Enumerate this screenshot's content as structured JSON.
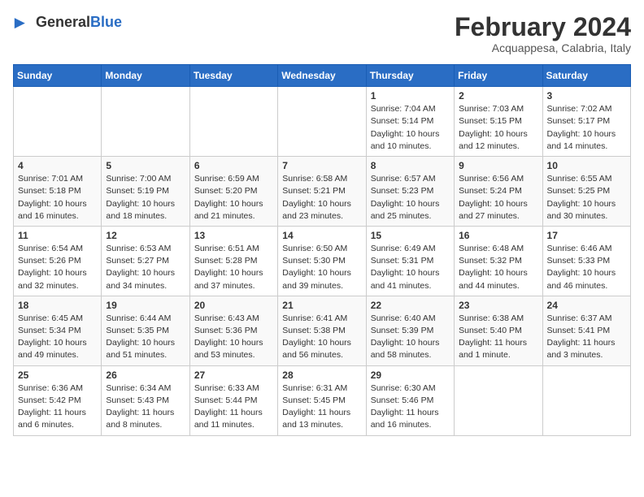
{
  "logo": {
    "text_general": "General",
    "text_blue": "Blue",
    "icon": "▶"
  },
  "title": "February 2024",
  "subtitle": "Acquappesa, Calabria, Italy",
  "days_of_week": [
    "Sunday",
    "Monday",
    "Tuesday",
    "Wednesday",
    "Thursday",
    "Friday",
    "Saturday"
  ],
  "weeks": [
    [
      {
        "day": "",
        "info": ""
      },
      {
        "day": "",
        "info": ""
      },
      {
        "day": "",
        "info": ""
      },
      {
        "day": "",
        "info": ""
      },
      {
        "day": "1",
        "info": "Sunrise: 7:04 AM\nSunset: 5:14 PM\nDaylight: 10 hours\nand 10 minutes."
      },
      {
        "day": "2",
        "info": "Sunrise: 7:03 AM\nSunset: 5:15 PM\nDaylight: 10 hours\nand 12 minutes."
      },
      {
        "day": "3",
        "info": "Sunrise: 7:02 AM\nSunset: 5:17 PM\nDaylight: 10 hours\nand 14 minutes."
      }
    ],
    [
      {
        "day": "4",
        "info": "Sunrise: 7:01 AM\nSunset: 5:18 PM\nDaylight: 10 hours\nand 16 minutes."
      },
      {
        "day": "5",
        "info": "Sunrise: 7:00 AM\nSunset: 5:19 PM\nDaylight: 10 hours\nand 18 minutes."
      },
      {
        "day": "6",
        "info": "Sunrise: 6:59 AM\nSunset: 5:20 PM\nDaylight: 10 hours\nand 21 minutes."
      },
      {
        "day": "7",
        "info": "Sunrise: 6:58 AM\nSunset: 5:21 PM\nDaylight: 10 hours\nand 23 minutes."
      },
      {
        "day": "8",
        "info": "Sunrise: 6:57 AM\nSunset: 5:23 PM\nDaylight: 10 hours\nand 25 minutes."
      },
      {
        "day": "9",
        "info": "Sunrise: 6:56 AM\nSunset: 5:24 PM\nDaylight: 10 hours\nand 27 minutes."
      },
      {
        "day": "10",
        "info": "Sunrise: 6:55 AM\nSunset: 5:25 PM\nDaylight: 10 hours\nand 30 minutes."
      }
    ],
    [
      {
        "day": "11",
        "info": "Sunrise: 6:54 AM\nSunset: 5:26 PM\nDaylight: 10 hours\nand 32 minutes."
      },
      {
        "day": "12",
        "info": "Sunrise: 6:53 AM\nSunset: 5:27 PM\nDaylight: 10 hours\nand 34 minutes."
      },
      {
        "day": "13",
        "info": "Sunrise: 6:51 AM\nSunset: 5:28 PM\nDaylight: 10 hours\nand 37 minutes."
      },
      {
        "day": "14",
        "info": "Sunrise: 6:50 AM\nSunset: 5:30 PM\nDaylight: 10 hours\nand 39 minutes."
      },
      {
        "day": "15",
        "info": "Sunrise: 6:49 AM\nSunset: 5:31 PM\nDaylight: 10 hours\nand 41 minutes."
      },
      {
        "day": "16",
        "info": "Sunrise: 6:48 AM\nSunset: 5:32 PM\nDaylight: 10 hours\nand 44 minutes."
      },
      {
        "day": "17",
        "info": "Sunrise: 6:46 AM\nSunset: 5:33 PM\nDaylight: 10 hours\nand 46 minutes."
      }
    ],
    [
      {
        "day": "18",
        "info": "Sunrise: 6:45 AM\nSunset: 5:34 PM\nDaylight: 10 hours\nand 49 minutes."
      },
      {
        "day": "19",
        "info": "Sunrise: 6:44 AM\nSunset: 5:35 PM\nDaylight: 10 hours\nand 51 minutes."
      },
      {
        "day": "20",
        "info": "Sunrise: 6:43 AM\nSunset: 5:36 PM\nDaylight: 10 hours\nand 53 minutes."
      },
      {
        "day": "21",
        "info": "Sunrise: 6:41 AM\nSunset: 5:38 PM\nDaylight: 10 hours\nand 56 minutes."
      },
      {
        "day": "22",
        "info": "Sunrise: 6:40 AM\nSunset: 5:39 PM\nDaylight: 10 hours\nand 58 minutes."
      },
      {
        "day": "23",
        "info": "Sunrise: 6:38 AM\nSunset: 5:40 PM\nDaylight: 11 hours\nand 1 minute."
      },
      {
        "day": "24",
        "info": "Sunrise: 6:37 AM\nSunset: 5:41 PM\nDaylight: 11 hours\nand 3 minutes."
      }
    ],
    [
      {
        "day": "25",
        "info": "Sunrise: 6:36 AM\nSunset: 5:42 PM\nDaylight: 11 hours\nand 6 minutes."
      },
      {
        "day": "26",
        "info": "Sunrise: 6:34 AM\nSunset: 5:43 PM\nDaylight: 11 hours\nand 8 minutes."
      },
      {
        "day": "27",
        "info": "Sunrise: 6:33 AM\nSunset: 5:44 PM\nDaylight: 11 hours\nand 11 minutes."
      },
      {
        "day": "28",
        "info": "Sunrise: 6:31 AM\nSunset: 5:45 PM\nDaylight: 11 hours\nand 13 minutes."
      },
      {
        "day": "29",
        "info": "Sunrise: 6:30 AM\nSunset: 5:46 PM\nDaylight: 11 hours\nand 16 minutes."
      },
      {
        "day": "",
        "info": ""
      },
      {
        "day": "",
        "info": ""
      }
    ]
  ]
}
